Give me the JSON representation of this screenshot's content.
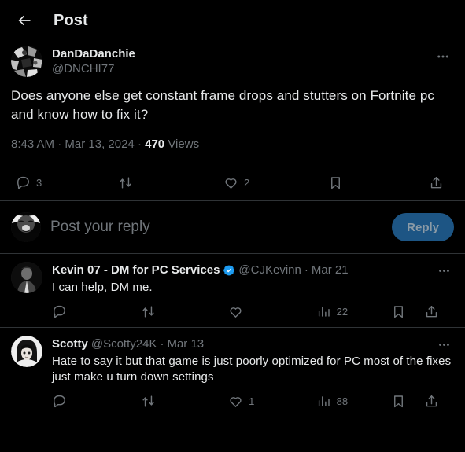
{
  "header": {
    "back_icon": "arrow-left-icon",
    "title": "Post"
  },
  "post": {
    "display_name": "DanDaDanchie",
    "handle": "@DNCHI77",
    "body": "Does anyone else get constant frame drops and stutters on Fortnite pc and know how to fix it?",
    "time": "8:43 AM",
    "separator1": " · ",
    "date": "Mar 13, 2024",
    "separator2": " · ",
    "views_count": "470",
    "views_label": " Views",
    "more_icon": "more-horizontal-icon",
    "actions": {
      "reply": {
        "icon": "reply-icon",
        "count": "3"
      },
      "retweet": {
        "icon": "retweet-icon",
        "count": ""
      },
      "like": {
        "icon": "heart-icon",
        "count": "2"
      },
      "bookmark": {
        "icon": "bookmark-icon",
        "count": ""
      },
      "share": {
        "icon": "share-icon",
        "count": ""
      }
    }
  },
  "composer": {
    "placeholder": "Post your reply",
    "reply_button_label": "Reply",
    "avatar_icon": "user-avatar-icon"
  },
  "replies": [
    {
      "display_name": "Kevin 07 - DM for PC Services",
      "verified": true,
      "handle": "@CJKevinn",
      "dot": "·",
      "date": "Mar 21",
      "text": "I can help, DM me.",
      "more_icon": "more-horizontal-icon",
      "actions": {
        "reply": {
          "icon": "reply-icon",
          "count": ""
        },
        "retweet": {
          "icon": "retweet-icon",
          "count": ""
        },
        "like": {
          "icon": "heart-icon",
          "count": ""
        },
        "views": {
          "icon": "views-bar-chart-icon",
          "count": "22"
        },
        "bookmark": {
          "icon": "bookmark-icon",
          "count": ""
        },
        "share": {
          "icon": "share-icon",
          "count": ""
        }
      }
    },
    {
      "display_name": "Scotty",
      "verified": false,
      "handle": "@Scotty24K",
      "dot": "·",
      "date": "Mar 13",
      "text": "Hate to say it but that game is just poorly optimized for PC most of the fixes just make u turn down settings",
      "more_icon": "more-horizontal-icon",
      "actions": {
        "reply": {
          "icon": "reply-icon",
          "count": ""
        },
        "retweet": {
          "icon": "retweet-icon",
          "count": ""
        },
        "like": {
          "icon": "heart-icon",
          "count": "1"
        },
        "views": {
          "icon": "views-bar-chart-icon",
          "count": "88"
        },
        "bookmark": {
          "icon": "bookmark-icon",
          "count": ""
        },
        "share": {
          "icon": "share-icon",
          "count": ""
        }
      }
    }
  ],
  "colors": {
    "background": "#000000",
    "text_primary": "#e7e9ea",
    "text_secondary": "#71767b",
    "divider": "#2f3336",
    "verified_badge": "#1d9bf0",
    "reply_button_bg": "#1d5584",
    "reply_button_text": "#8b9aa6"
  }
}
